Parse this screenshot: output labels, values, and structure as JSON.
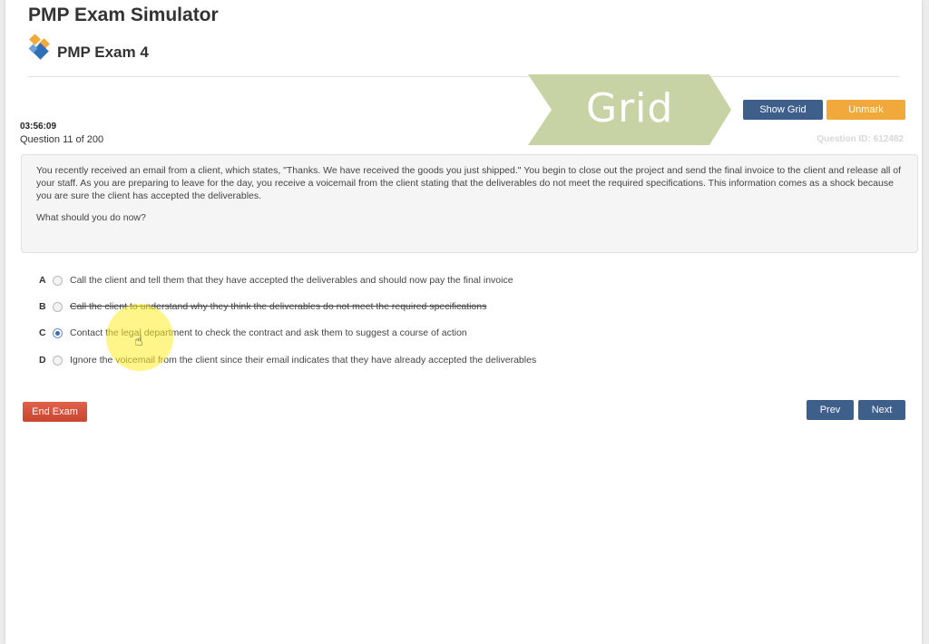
{
  "app": {
    "title": "PMP Exam Simulator",
    "exam_name": "PMP Exam 4"
  },
  "banner": {
    "text": "Grid",
    "color": "#c8d3a5"
  },
  "toolbar": {
    "show_grid_label": "Show Grid",
    "unmark_label": "Unmark"
  },
  "status": {
    "timer": "03:56:09",
    "question_counter": "Question 11 of 200",
    "question_id": "Question ID: 612482"
  },
  "question": {
    "text": "You recently received an email from a client, which states, \"Thanks. We have received the goods you just shipped.\" You begin to close out the project and send the final invoice to the client and release all of your staff. As you are preparing to leave for the day, you receive a voicemail from the client stating that the deliverables do not meet the required specifications. This information comes as a shock because you are sure the client has accepted the deliverables.",
    "prompt": "What should you do now?"
  },
  "answers": [
    {
      "letter": "A",
      "text": "Call the client and tell them that they have accepted the deliverables and should now pay the final invoice",
      "selected": false,
      "struck": false
    },
    {
      "letter": "B",
      "text": "Call the client to understand why they think the deliverables do not meet the required specifications",
      "selected": false,
      "struck": true
    },
    {
      "letter": "C",
      "text": "Contact the legal department to check the contract and ask them to suggest a course of action",
      "selected": true,
      "struck": false
    },
    {
      "letter": "D",
      "text": "Ignore the voicemail from the client since their email indicates that they have already accepted the deliverables",
      "selected": false,
      "struck": false
    }
  ],
  "footer": {
    "end_exam_label": "End Exam",
    "prev_label": "Prev",
    "next_label": "Next"
  },
  "colors": {
    "primary_button": "#3e5f8a",
    "unmark_button": "#f2a93b",
    "end_exam_button": "#d9534f"
  },
  "icons": {
    "logo": "diamond-logo-icon",
    "cursor": "hand-pointer-icon"
  }
}
